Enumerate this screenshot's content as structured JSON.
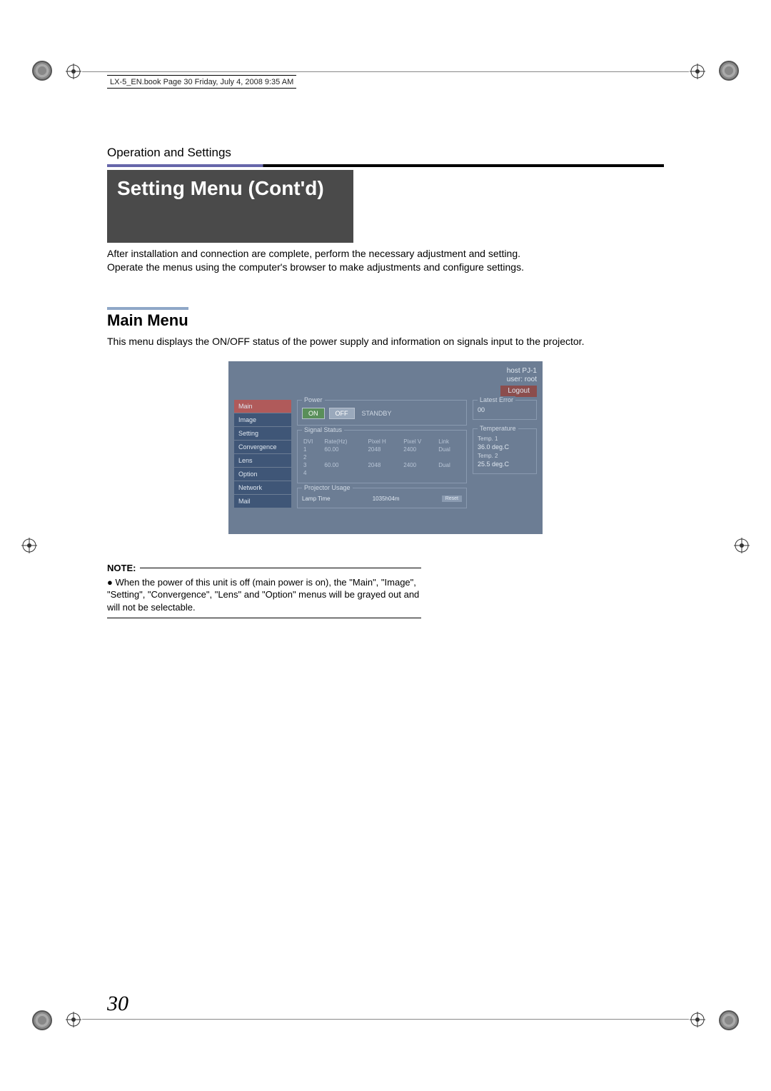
{
  "book_header": "LX-5_EN.book  Page 30  Friday, July 4, 2008  9:35 AM",
  "section_label": "Operation and Settings",
  "page_title": "Setting Menu (Cont'd)",
  "intro_line1": "After installation and connection are complete, perform the necessary adjustment and setting.",
  "intro_line2": "Operate the menus using the computer's browser to make adjustments and configure settings.",
  "h2": "Main Menu",
  "desc": "This menu displays the ON/OFF status of the power supply and information on signals input to the projector.",
  "proj": {
    "host": "host PJ-1",
    "user": "user: root",
    "logout": "Logout",
    "nav": [
      "Main",
      "Image",
      "Setting",
      "Convergence",
      "Lens",
      "Option",
      "Network",
      "Mail"
    ],
    "power": {
      "title": "Power",
      "on": "ON",
      "off": "OFF",
      "status": "STANDBY"
    },
    "signal": {
      "title": "Signal Status",
      "headers": [
        "DVI",
        "Rate(Hz)",
        "Pixel H",
        "Pixel V",
        "Link"
      ],
      "rows": [
        {
          "n": "1",
          "rate": "60.00",
          "ph": "2048",
          "pv": "2400",
          "link": "Dual"
        },
        {
          "n": "2",
          "rate": "",
          "ph": "",
          "pv": "",
          "link": ""
        },
        {
          "n": "3",
          "rate": "60.00",
          "ph": "2048",
          "pv": "2400",
          "link": "Dual"
        },
        {
          "n": "4",
          "rate": "",
          "ph": "",
          "pv": "",
          "link": ""
        }
      ]
    },
    "usage": {
      "title": "Projector Usage",
      "lamp_label": "Lamp Time",
      "lamp_value": "1035h04m",
      "reset": "Reset"
    },
    "error": {
      "title": "Latest Error",
      "value": "00"
    },
    "temp": {
      "title": "Temperature",
      "t1_label": "Temp. 1",
      "t1_value": "36.0 deg.C",
      "t2_label": "Temp. 2",
      "t2_value": "25.5 deg.C"
    }
  },
  "note": {
    "head": "NOTE:",
    "body": "When the power of this unit is off (main power is on), the \"Main\", \"Image\", \"Setting\", \"Convergence\", \"Lens\" and \"Option\" menus will be grayed out and will not be selectable."
  },
  "page_number": "30"
}
